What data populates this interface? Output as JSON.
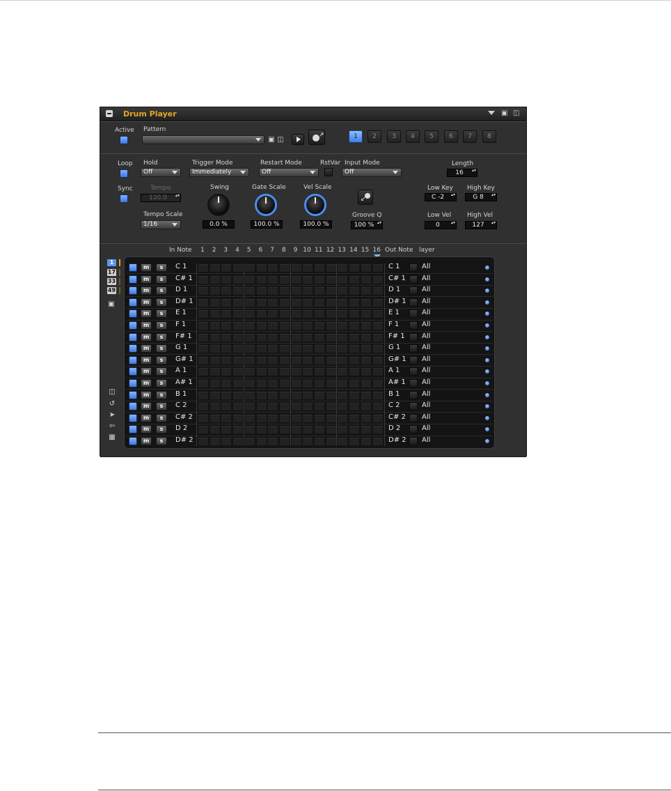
{
  "title": "Drum Player",
  "section1": {
    "active_label": "Active",
    "pattern_label": "Pattern",
    "pattern_value": "",
    "pattern_buttons": [
      "1",
      "2",
      "3",
      "4",
      "5",
      "6",
      "7",
      "8"
    ],
    "selected_pattern": "1"
  },
  "section2": {
    "loop_label": "Loop",
    "sync_label": "Sync",
    "hold_label": "Hold",
    "hold_value": "Off",
    "trigger_label": "Trigger Mode",
    "trigger_value": "Immediately",
    "restart_label": "Restart Mode",
    "restart_value": "Off",
    "rstvar_label": "RstVar",
    "input_label": "Input Mode",
    "input_value": "Off",
    "length_label": "Length",
    "length_value": "16",
    "tempo_label": "Tempo",
    "tempo_value": "120.0",
    "tempo_scale_label": "Tempo Scale",
    "tempo_scale_value": "1/16",
    "swing_label": "Swing",
    "swing_value": "0.0 %",
    "gate_label": "Gate Scale",
    "gate_value": "100.0 %",
    "vel_label": "Vel Scale",
    "vel_value": "100.0 %",
    "groove_label": "Groove Q",
    "groove_value": "100 %",
    "lowkey_label": "Low Key",
    "lowkey_value": "C -2",
    "highkey_label": "High Key",
    "highkey_value": "G 8",
    "lowvel_label": "Low Vel",
    "lowvel_value": "0",
    "highvel_label": "High Vel",
    "highvel_value": "127"
  },
  "grid": {
    "in_note_label": "In Note",
    "out_note_label": "Out Note",
    "layer_label": "layer",
    "steps": [
      "1",
      "2",
      "3",
      "4",
      "5",
      "6",
      "7",
      "8",
      "9",
      "10",
      "11",
      "12",
      "13",
      "14",
      "15",
      "16"
    ],
    "side_badges": [
      "1",
      "17",
      "33",
      "49"
    ],
    "mute_label": "m",
    "solo_label": "s",
    "rows": [
      {
        "in": "C 1",
        "out": "C 1",
        "layer": "All"
      },
      {
        "in": "C# 1",
        "out": "C# 1",
        "layer": "All"
      },
      {
        "in": "D 1",
        "out": "D 1",
        "layer": "All"
      },
      {
        "in": "D# 1",
        "out": "D# 1",
        "layer": "All"
      },
      {
        "in": "E 1",
        "out": "E 1",
        "layer": "All"
      },
      {
        "in": "F 1",
        "out": "F 1",
        "layer": "All"
      },
      {
        "in": "F# 1",
        "out": "F# 1",
        "layer": "All"
      },
      {
        "in": "G 1",
        "out": "G 1",
        "layer": "All"
      },
      {
        "in": "G# 1",
        "out": "G# 1",
        "layer": "All"
      },
      {
        "in": "A 1",
        "out": "A 1",
        "layer": "All"
      },
      {
        "in": "A# 1",
        "out": "A# 1",
        "layer": "All"
      },
      {
        "in": "B 1",
        "out": "B 1",
        "layer": "All"
      },
      {
        "in": "C 2",
        "out": "C 2",
        "layer": "All"
      },
      {
        "in": "C# 2",
        "out": "C# 2",
        "layer": "All"
      },
      {
        "in": "D 2",
        "out": "D 2",
        "layer": "All"
      },
      {
        "in": "D# 2",
        "out": "D# 2",
        "layer": "All"
      }
    ]
  },
  "colors": {
    "accent": "#e4a623",
    "blue": "#4a8df0",
    "panel": "#2c2c2c"
  }
}
